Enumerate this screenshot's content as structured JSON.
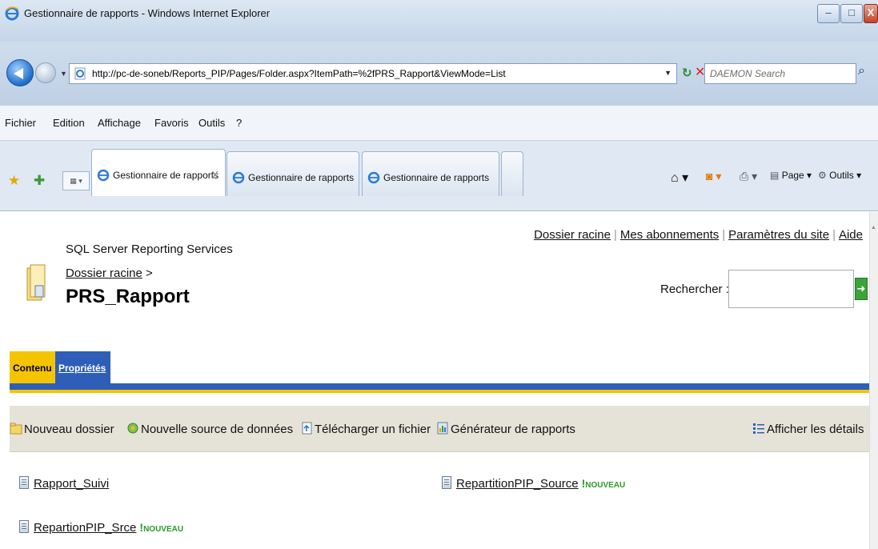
{
  "window": {
    "title": "Gestionnaire de rapports - Windows Internet Explorer",
    "controls": {
      "minimize": "‒",
      "maximize": "□",
      "close": "X"
    }
  },
  "address": {
    "url": "http://pc-de-soneb/Reports_PIP/Pages/Folder.aspx?ItemPath=%2fPRS_Rapport&ViewMode=List",
    "search_placeholder": "DAEMON Search"
  },
  "menu": [
    "Fichier",
    "Edition",
    "Affichage",
    "Favoris",
    "Outils",
    "?"
  ],
  "tabs": [
    {
      "label": "Gestionnaire de rapports",
      "close": "X"
    },
    {
      "label": "Gestionnaire de rapports"
    },
    {
      "label": "Gestionnaire de rapports"
    }
  ],
  "commands": {
    "page": "Page ▾",
    "tools": "Outils ▾"
  },
  "page": {
    "product": "SQL Server Reporting Services",
    "breadcrumb_link": "Dossier racine",
    "breadcrumb_sep": " >",
    "title": "PRS_Rapport",
    "toplinks": [
      "Dossier racine",
      "Mes abonnements",
      "Paramètres du site",
      "Aide"
    ],
    "search_label": "Rechercher :",
    "search_go": "➜",
    "tabs": [
      "Contenu",
      "Propriétés"
    ],
    "toolbar": {
      "new_folder": "Nouveau dossier",
      "new_datasource": "Nouvelle source de données",
      "upload": "Télécharger un fichier",
      "report_builder": "Générateur de rapports",
      "details": "Afficher les détails"
    },
    "items": [
      {
        "name": "Rapport_Suivi",
        "new": false
      },
      {
        "name": "RepartitionPIP_Source",
        "new": true,
        "badge": "NOUVEAU"
      },
      {
        "name": "RepartionPIP_Srce",
        "new": true,
        "badge": "NOUVEAU"
      }
    ]
  },
  "colors": {
    "accent_yellow": "#f5c400",
    "accent_blue": "#2e5eb7",
    "toolbar_bg": "#e5e3d8"
  }
}
